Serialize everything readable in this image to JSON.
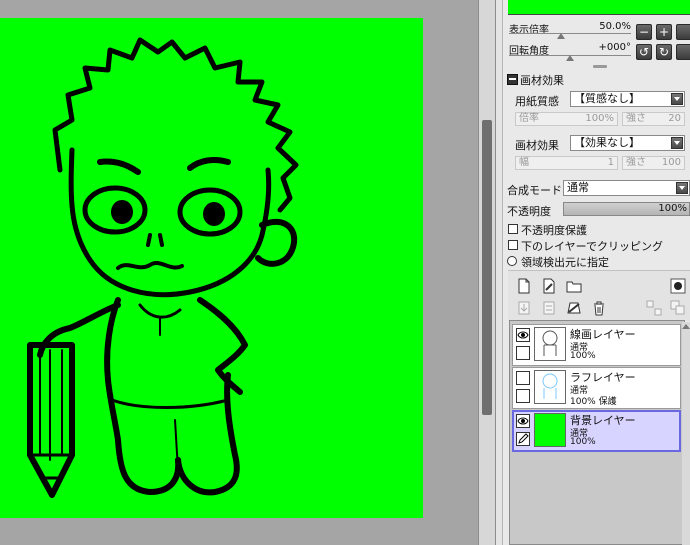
{
  "view": {
    "zoom_label": "表示倍率",
    "zoom_value": "50.0%",
    "zoom_level_percent": 50.0,
    "rotation_label": "回転角度",
    "rotation_value": "+000°",
    "rotation_degrees": 0
  },
  "material_effect": {
    "section_title": "画材効果",
    "paper_texture_label": "用紙質感",
    "paper_texture_value": "【質感なし】",
    "magnification_label": "倍率",
    "magnification_value": "100%",
    "strength_label": "強さ",
    "strength_value": "20",
    "effect_label": "画材効果",
    "effect_value": "【効果なし】",
    "width_label": "幅",
    "width_value": "1",
    "effect_strength_label": "強さ",
    "effect_strength_value": "100"
  },
  "layer_props": {
    "blend_mode_label": "合成モード",
    "blend_mode_value": "通常",
    "opacity_label": "不透明度",
    "opacity_value": "100%",
    "opacity_percent": 100,
    "preserve_opacity_label": "不透明度保護",
    "clipping_label": "下のレイヤーでクリッピング",
    "selection_source_label": "領域検出元に指定"
  },
  "layers": [
    {
      "name": "線画レイヤー",
      "mode": "通常",
      "opacity": "100%",
      "visible": true,
      "selected": false
    },
    {
      "name": "ラフレイヤー",
      "mode": "通常",
      "opacity": "100%",
      "protect": "保護",
      "visible": false,
      "selected": false
    },
    {
      "name": "背景レイヤー",
      "mode": "通常",
      "opacity": "100%",
      "visible": true,
      "selected": true
    }
  ],
  "colors": {
    "canvas_background": "#00ff00",
    "selected_layer": "#d7d5ff"
  }
}
